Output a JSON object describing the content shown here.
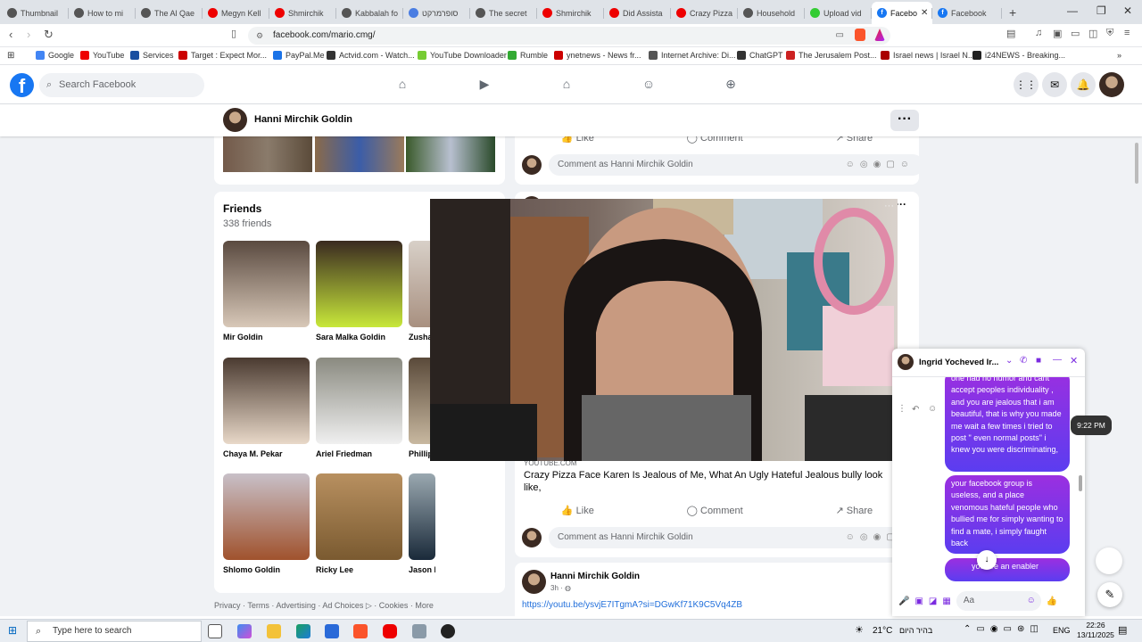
{
  "browser": {
    "tabs": [
      {
        "label": "Thumbnail",
        "color": "#555"
      },
      {
        "label": "How to mi",
        "color": "#555"
      },
      {
        "label": "The Al Qae",
        "color": "#555"
      },
      {
        "label": "Megyn Kell",
        "color": "#e00"
      },
      {
        "label": "Shmirchik",
        "color": "#e00"
      },
      {
        "label": "Kabbalah fo",
        "color": "#555"
      },
      {
        "label": "סופרמרקט",
        "color": "#4a7de2"
      },
      {
        "label": "The secret",
        "color": "#555"
      },
      {
        "label": "Shmirchik",
        "color": "#e00"
      },
      {
        "label": "Did Assista",
        "color": "#e00"
      },
      {
        "label": "Crazy Pizza",
        "color": "#e00"
      },
      {
        "label": "Household",
        "color": "#555"
      },
      {
        "label": "Upload vid",
        "color": "#3c3"
      }
    ],
    "active_tab": "Facebo",
    "last_tab": "Facebook",
    "url": "facebook.com/mario.cmg/",
    "bookmarks": [
      "Google",
      "YouTube",
      "Services",
      "Target : Expect Mor...",
      "PayPal.Me",
      "Actvid.com - Watch...",
      "YouTube Downloader",
      "Rumble",
      "ynetnews - News fr...",
      "Internet Archive: Di...",
      "ChatGPT",
      "The Jerusalem Post...",
      "Israel news | Israel N...",
      "i24NEWS - Breaking..."
    ]
  },
  "facebook": {
    "search_placeholder": "Search Facebook",
    "profile_name": "Hanni Mirchik Goldin",
    "friends": {
      "title": "Friends",
      "count": "338 friends",
      "list": [
        "Mir Goldin",
        "Sara Malka Goldin",
        "Zusha",
        "Chaya M. Pekar",
        "Ariel Friedman",
        "Phillip",
        "Shlomo Goldin",
        "Ricky Lee",
        "Jason Franks"
      ]
    },
    "footer": "Privacy · Terms · Advertising · Ad Choices ▷ · Cookies · More",
    "actions": {
      "like": "Like",
      "comment": "Comment",
      "share": "Share"
    },
    "comment_placeholder": "Comment as Hanni Mirchik Goldin",
    "post": {
      "source": "YOUTUBE.COM",
      "title": "Crazy Pizza Face Karen Is Jealous of Me, What An Ugly Hateful Jealous bully look like,",
      "author": "Hanni Mirchik Goldin",
      "time": "3h · ",
      "link": "https://youtu.be/ysvjE7ITgmA?si=DGwKf71K9C5Vq4ZB"
    }
  },
  "messenger": {
    "name": "Ingrid Yocheved Ir...",
    "time": "9:22 PM",
    "messages": [
      "one had no humor and cant accept peoples individuality , and you are jealous that i am beautiful, that is why you made me wait a few times i tried to post \" even normal posts\" i knew you were discriminating,",
      "your facebook group is useless, and a place venomous hateful people who bullied me for simply wanting to find a mate, i simply faught back",
      "you are an enabler"
    ],
    "input_placeholder": "Aa"
  },
  "taskbar": {
    "search_placeholder": "Type here to search",
    "weather": "21°C",
    "weather_text": "בהיר היום",
    "lang": "ENG",
    "time": "22:26",
    "date": "13/11/2025"
  }
}
